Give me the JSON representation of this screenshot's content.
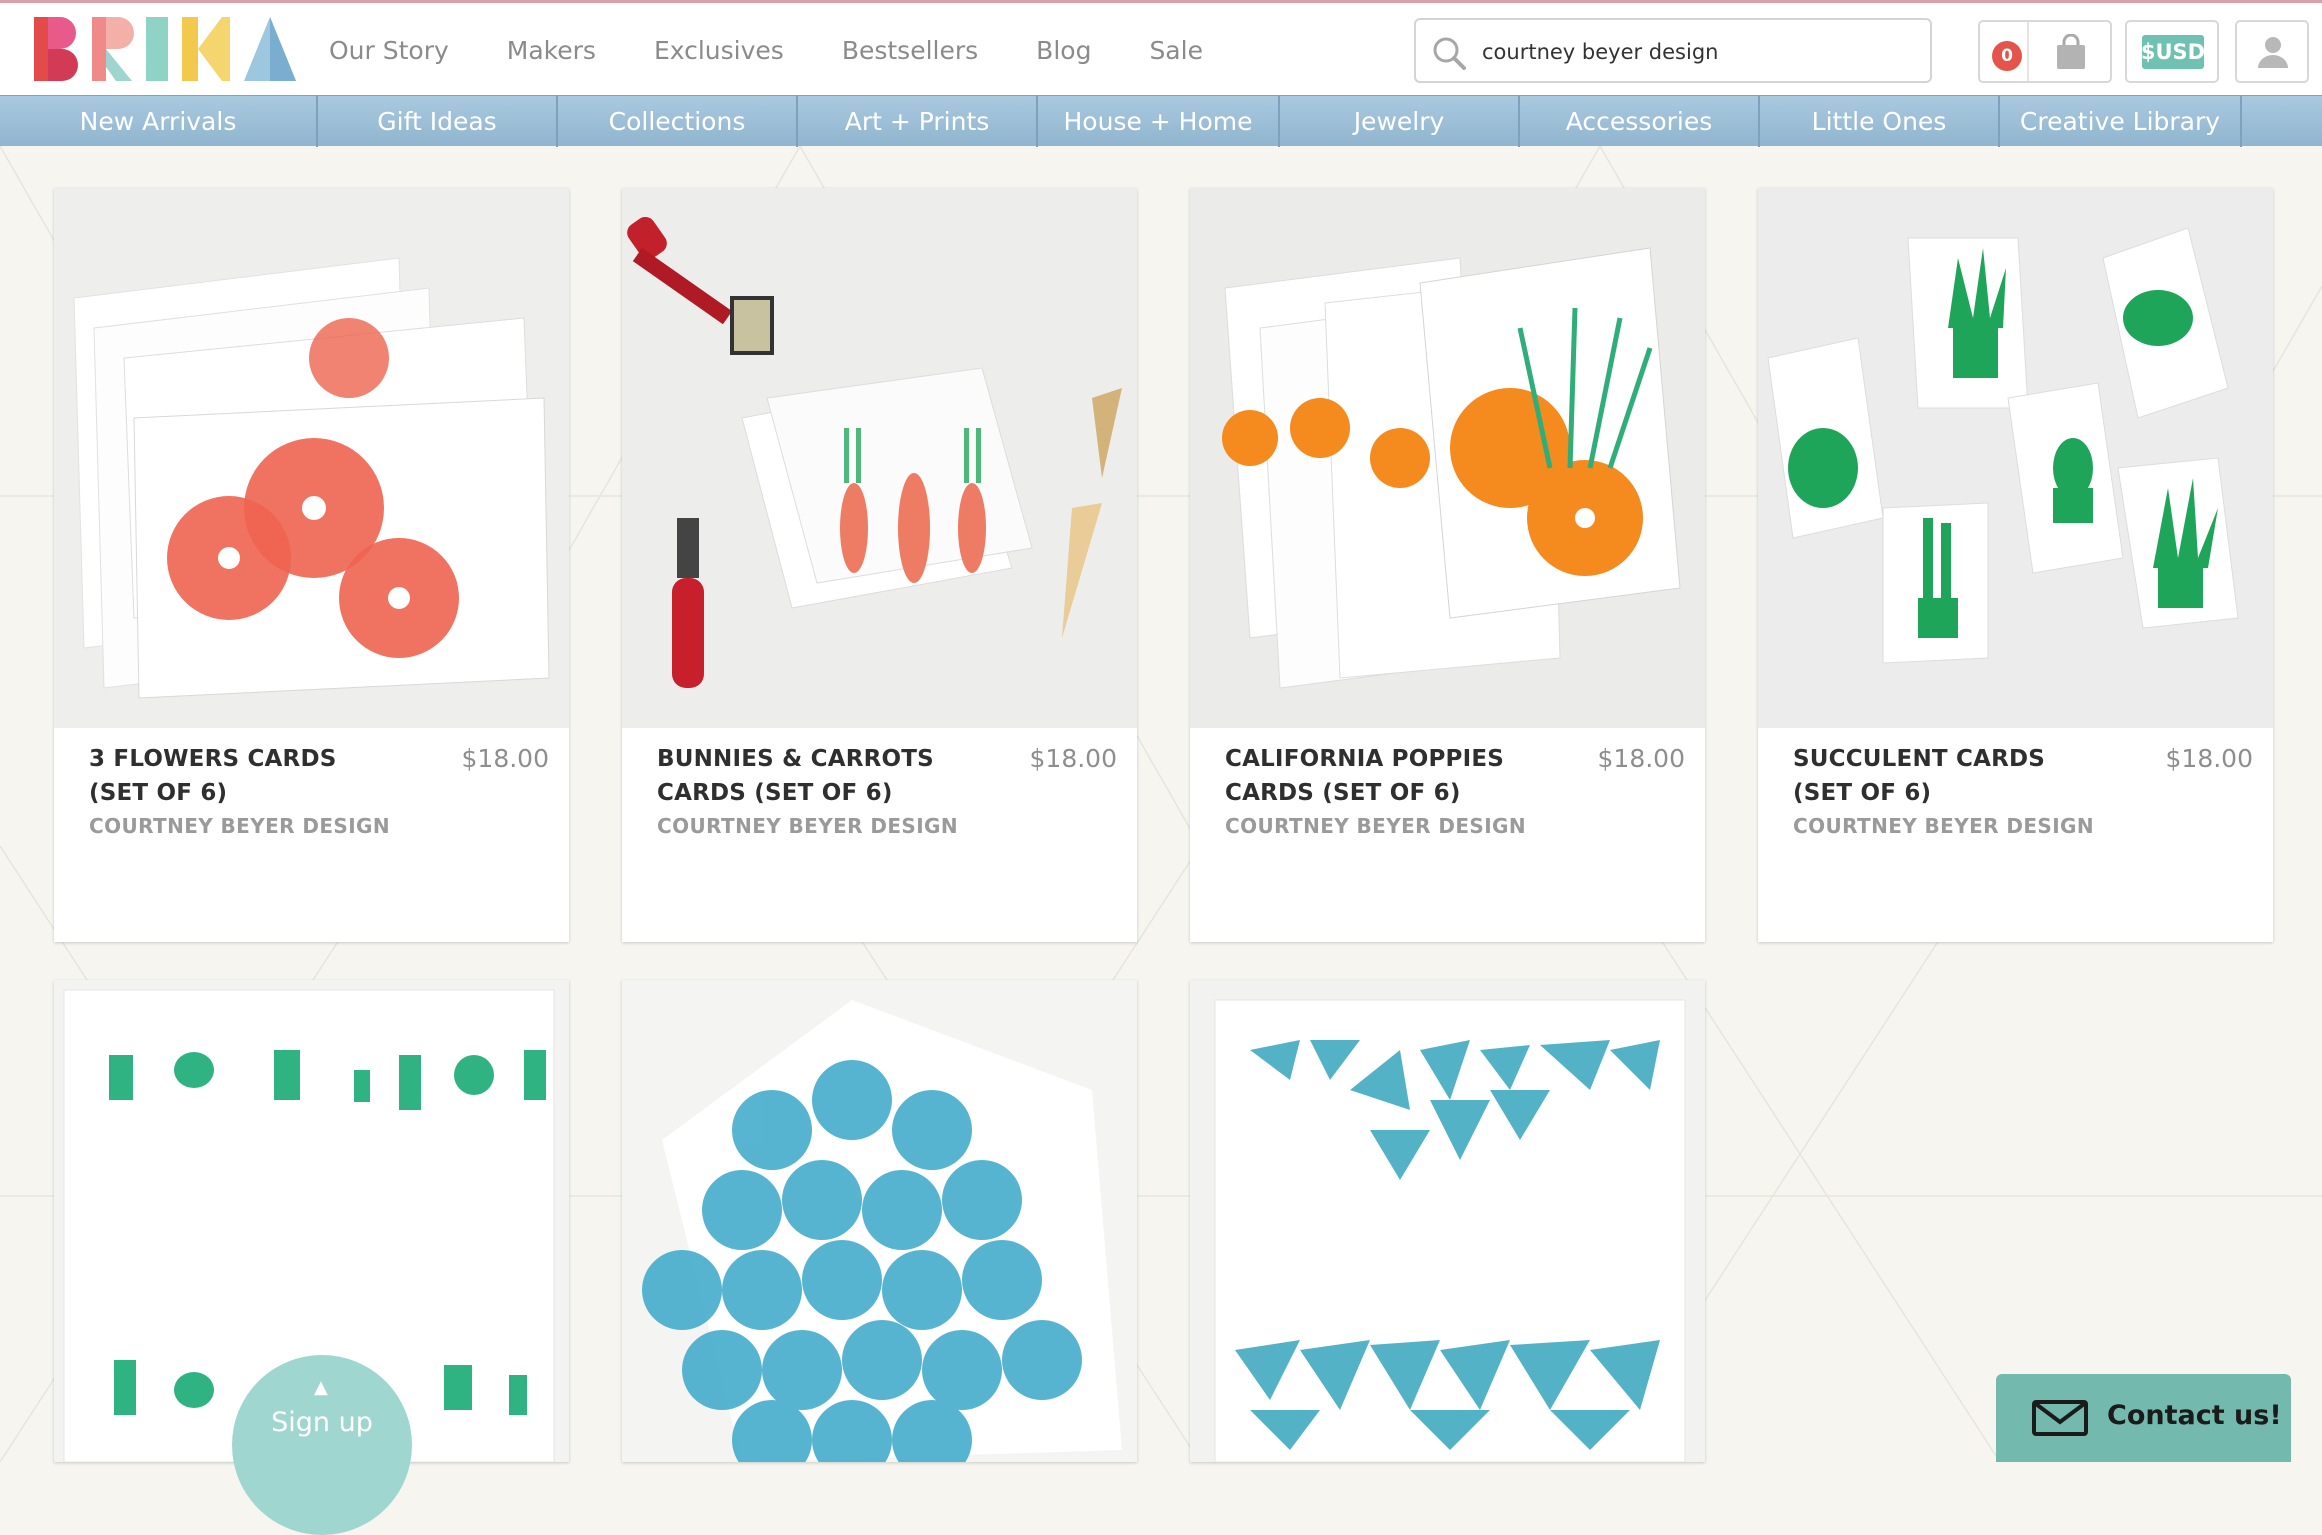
{
  "brand": {
    "logo_text": "BRIKA"
  },
  "top_nav": [
    "Our Story",
    "Makers",
    "Exclusives",
    "Bestsellers",
    "Blog",
    "Sale"
  ],
  "search": {
    "value": "courtney beyer design"
  },
  "cart": {
    "count": "0"
  },
  "currency": {
    "label": "$USD"
  },
  "category_nav": [
    "New Arrivals",
    "Gift Ideas",
    "Collections",
    "Art + Prints",
    "House + Home",
    "Jewelry",
    "Accessories",
    "Little Ones",
    "Creative Library"
  ],
  "products": [
    {
      "title": "3 FLOWERS CARDS (SET OF 6)",
      "price": "$18.00",
      "maker": "COURTNEY BEYER DESIGN"
    },
    {
      "title": "BUNNIES & CARROTS CARDS (SET OF 6)",
      "price": "$18.00",
      "maker": "COURTNEY BEYER DESIGN"
    },
    {
      "title": "CALIFORNIA POPPIES CARDS (SET OF 6)",
      "price": "$18.00",
      "maker": "COURTNEY BEYER DESIGN"
    },
    {
      "title": "SUCCULENT CARDS (SET OF 6)",
      "price": "$18.00",
      "maker": "COURTNEY BEYER DESIGN"
    }
  ],
  "widgets": {
    "signup_label": "Sign up",
    "contact_label": "Contact us!"
  },
  "colors": {
    "nav_blue": "#a9c9df",
    "accent_red": "#e5544a",
    "accent_teal": "#6fc1b1",
    "contact_teal": "#74b9ad",
    "signup_teal": "#9fd6d0",
    "flower_coral": "#ee6450",
    "poppy_orange": "#f58a1f",
    "succulent_green": "#1fa559",
    "towel_blue": "#3aa8c9"
  }
}
